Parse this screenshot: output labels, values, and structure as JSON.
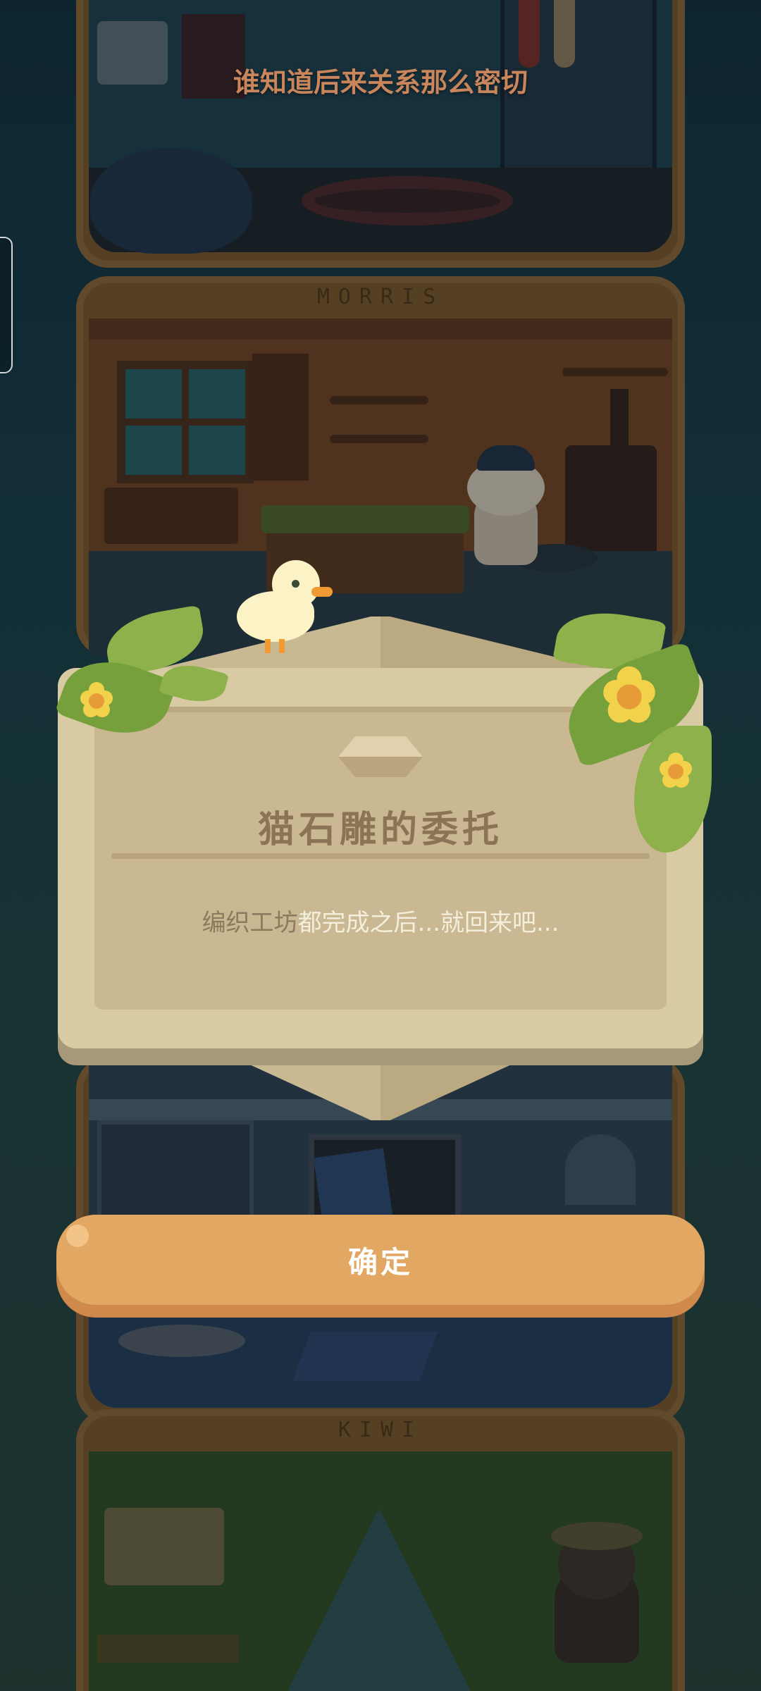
{
  "caption": "谁知道后来关系那么密切",
  "rooms": [
    {
      "sign": ""
    },
    {
      "sign": "MORRIS"
    },
    {
      "sign": ""
    },
    {
      "sign": "KIWI"
    }
  ],
  "dialog": {
    "title": "猫石雕的委托",
    "message_muted": "编织工坊",
    "message": "都完成之后...就回来吧..."
  },
  "confirm_button": {
    "label": "确定"
  },
  "colors": {
    "panel": "#d8caa2",
    "panel_inner": "#c9b891",
    "title": "#8b7456",
    "button": "#e2a863",
    "caption": "#c9855b"
  }
}
